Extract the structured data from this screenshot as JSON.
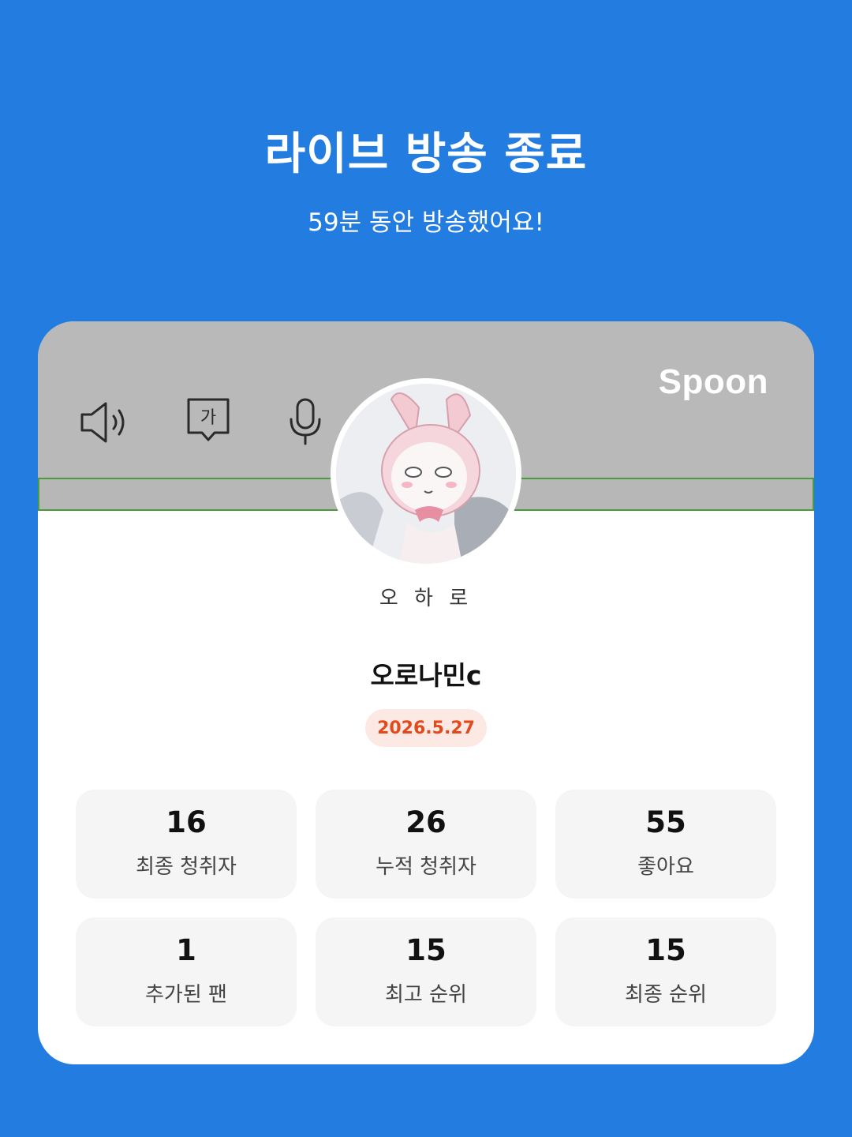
{
  "header": {
    "title": "라이브 방송 종료",
    "subtitle": "59분 동안 방송했어요!"
  },
  "card": {
    "brand": "Spoon",
    "controls": [
      {
        "icon": "speaker-icon"
      },
      {
        "icon": "caption-icon",
        "glyph": "가"
      },
      {
        "icon": "microphone-icon"
      }
    ],
    "host_label": "오 하 로",
    "nickname": "오로나민c",
    "date": "2026.5.27",
    "stats": [
      {
        "value": "16",
        "label": "최종 청취자"
      },
      {
        "value": "26",
        "label": "누적 청취자"
      },
      {
        "value": "55",
        "label": "좋아요"
      },
      {
        "value": "1",
        "label": "추가된 팬"
      },
      {
        "value": "15",
        "label": "최고 순위"
      },
      {
        "value": "15",
        "label": "최종 순위"
      }
    ]
  },
  "colors": {
    "background": "#237de1",
    "banner": "#b9b9b9",
    "date_text": "#e14a1c",
    "date_bg": "#fde9e3",
    "stat_bg": "#f5f5f5"
  }
}
